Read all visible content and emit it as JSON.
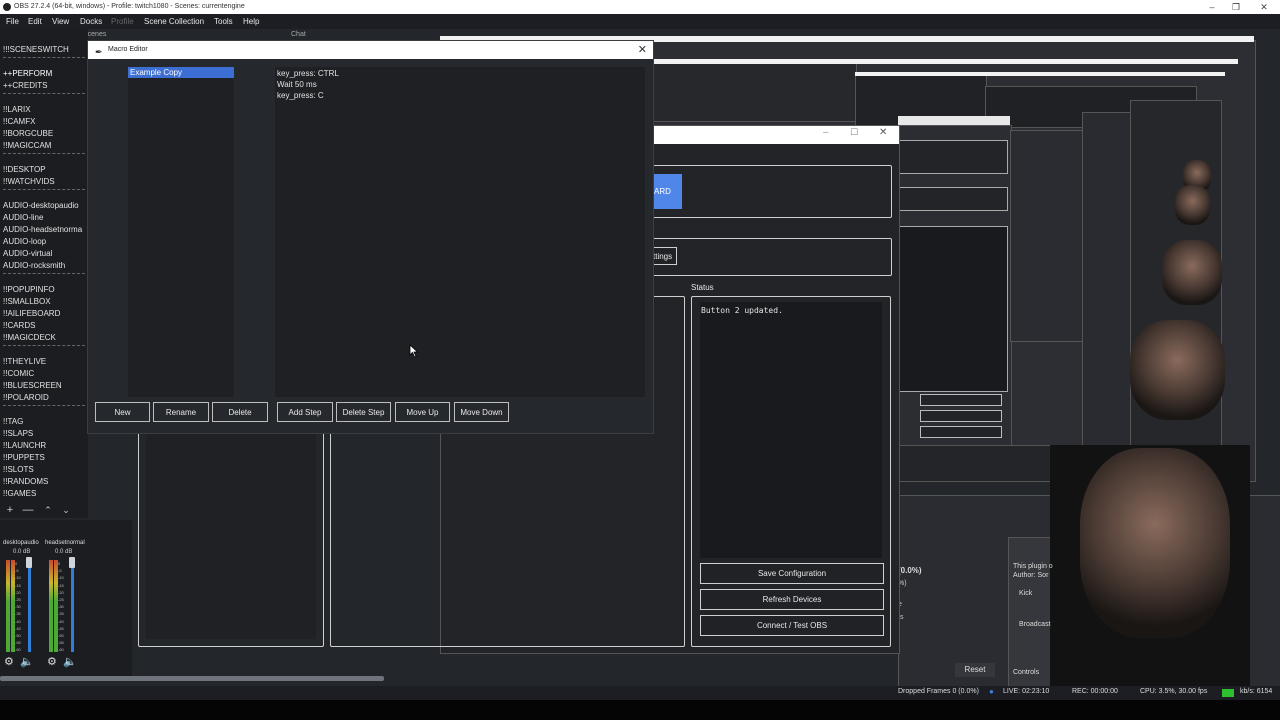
{
  "window_title": "OBS 27.2.4 (64-bit, windows) - Profile: twitch1080 - Scenes: currentengine",
  "menu": [
    "File",
    "Edit",
    "View",
    "Docks",
    "Profile",
    "Scene Collection",
    "Tools",
    "Help"
  ],
  "docks": {
    "scenes_label": "Scenes",
    "chat_label": "Chat"
  },
  "scenes": [
    "!!!SCENESWITCH",
    "++PERFORM",
    "++CREDITS",
    "!!LARIX",
    "!!CAMFX",
    "!!BORGCUBE",
    "!!MAGICCAM",
    "!!DESKTOP",
    "!!WATCHVIDS",
    "AUDIO-desktopaudio",
    "AUDIO-line",
    "AUDIO-headsetnorma",
    "AUDIO-loop",
    "AUDIO-virtual",
    "AUDIO-rocksmith",
    "!!POPUPINFO",
    "!!SMALLBOX",
    "!!AILIFEBOARD",
    "!!CARDS",
    "!!MAGICDECK",
    "!!THEYLIVE",
    "!!COMIC",
    "!!BLUESCREEN",
    "!!POLAROID",
    "!!TAG",
    "!!SLAPS",
    "!!LAUNCHR",
    "!!PUPPETS",
    "!!SLOTS",
    "!!RANDOMS",
    "!!GAMES"
  ],
  "mixer": {
    "channels": [
      {
        "name": "desktopaudio",
        "db": "0.0 dB"
      },
      {
        "name": "headsetnormal",
        "db": "0.0 dB"
      }
    ],
    "scale": [
      "0",
      "-5",
      "-10",
      "-15",
      "-20",
      "-25",
      "-30",
      "-35",
      "-40",
      "-45",
      "-50",
      "-55",
      "-60"
    ]
  },
  "macro_editor": {
    "title": "Macro Editor",
    "macros": [
      "Example Copy"
    ],
    "steps": [
      "key_press: CTRL",
      "Wait 50 ms",
      "key_press: C"
    ],
    "buttons": {
      "new": "New",
      "rename": "Rename",
      "delete": "Delete",
      "add_step": "Add Step",
      "delete_step": "Delete Step",
      "move_up": "Move Up",
      "move_down": "Move Down"
    }
  },
  "plugin_window": {
    "board_button_fragment": "ARD",
    "settings_button_fragment": "ttings",
    "status_label": "Status",
    "status_text": "Button 2 updated.",
    "save_button": "Save Configuration",
    "refresh_button": "Refresh Devices",
    "connect_button": "Connect / Test OBS"
  },
  "background_fragments": {
    "stats_pct": "(0.0%)",
    "stats_pct2": "%)",
    "stats_e": "e",
    "stats_s": "/s",
    "plugin_info": "This plugin o",
    "author": "Author: Sor",
    "kick": "Kick",
    "broadcast": "Broadcast",
    "reset": "Reset",
    "controls": "Controls"
  },
  "statusbar": {
    "dropped_frames": "Dropped Frames 0 (0.0%)",
    "live": "LIVE: 02:23:10",
    "rec": "REC: 00:00:00",
    "cpu": "CPU: 3.5%, 30.00 fps",
    "kbps": "kb/s: 6154"
  },
  "colors": {
    "selection": "#3d6ed4",
    "accent_button": "#4f86e8",
    "fader": "#2f7fd6"
  }
}
